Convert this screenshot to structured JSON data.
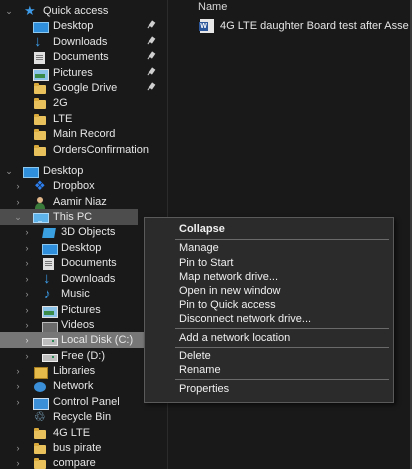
{
  "nav": {
    "quick_access": "Quick access",
    "desktop_qa": "Desktop",
    "downloads_qa": "Downloads",
    "documents_qa": "Documents",
    "pictures_qa": "Pictures",
    "google_drive": "Google Drive",
    "f_2g": "2G",
    "f_lte": "LTE",
    "f_main_record": "Main Record",
    "f_orders": "OrdersConfirmation",
    "desktop_root": "Desktop",
    "dropbox": "Dropbox",
    "aamir_niaz": "Aamir Niaz",
    "this_pc": "This PC",
    "objects_3d": "3D Objects",
    "pc_desktop": "Desktop",
    "pc_documents": "Documents",
    "pc_downloads": "Downloads",
    "pc_music": "Music",
    "pc_pictures": "Pictures",
    "pc_videos": "Videos",
    "local_disk": "Local Disk (C:)",
    "free_d": "Free (D:)",
    "libraries": "Libraries",
    "network": "Network",
    "control_panel": "Control Panel",
    "recycle_bin": "Recycle Bin",
    "f_4g_lte": "4G LTE",
    "bus_pirate": "bus pirate",
    "compare": "compare"
  },
  "content": {
    "column_header": "Name",
    "file_name": "4G LTE daughter Board test after Asse"
  },
  "menu": {
    "collapse": "Collapse",
    "manage": "Manage",
    "pin_to_start": "Pin to Start",
    "map_network_drive": "Map network drive...",
    "open_in_new_window": "Open in new window",
    "pin_to_quick_access": "Pin to Quick access",
    "disconnect_network_drive": "Disconnect network drive...",
    "add_network_location": "Add a network location",
    "delete": "Delete",
    "rename": "Rename",
    "properties": "Properties"
  },
  "icons": {
    "word_badge": "W"
  }
}
